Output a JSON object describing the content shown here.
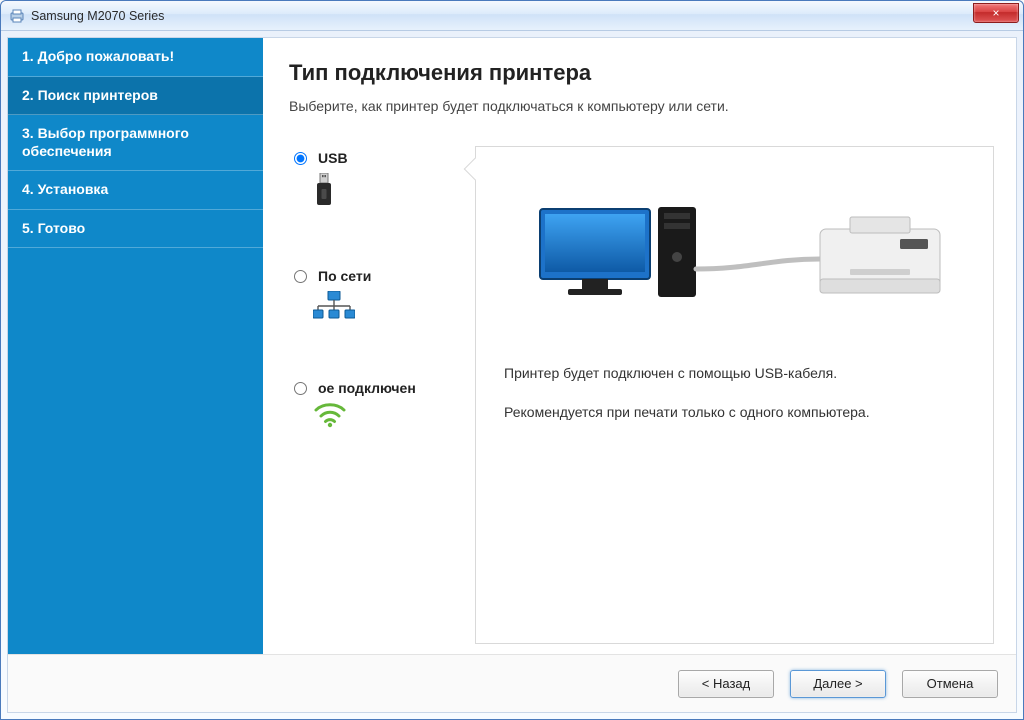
{
  "window": {
    "title": "Samsung M2070 Series",
    "close_icon": "×"
  },
  "sidebar": {
    "steps": [
      {
        "label": "1. Добро пожаловать!"
      },
      {
        "label": "2. Поиск принтеров"
      },
      {
        "label": "3. Выбор программного обеспечения"
      },
      {
        "label": "4. Установка"
      },
      {
        "label": "5. Готово"
      }
    ],
    "active_index": 1
  },
  "main": {
    "heading": "Тип подключения принтера",
    "subtitle": "Выберите, как принтер будет подключаться к компьютеру или сети.",
    "options": [
      {
        "id": "usb",
        "label": "USB",
        "selected": true
      },
      {
        "id": "network",
        "label": "По сети",
        "selected": false
      },
      {
        "id": "wireless",
        "label": "ое подключен",
        "selected": false
      }
    ],
    "description": {
      "line1": "Принтер будет подключен с помощью USB-кабеля.",
      "line2": "Рекомендуется при печати только с одного компьютера."
    }
  },
  "footer": {
    "back": "< Назад",
    "next": "Далее >",
    "cancel": "Отмена"
  },
  "icons": {
    "app": "printer-app-icon",
    "close": "close-icon",
    "usb": "usb-stick-icon",
    "network": "network-icon",
    "wireless": "wifi-icon"
  }
}
